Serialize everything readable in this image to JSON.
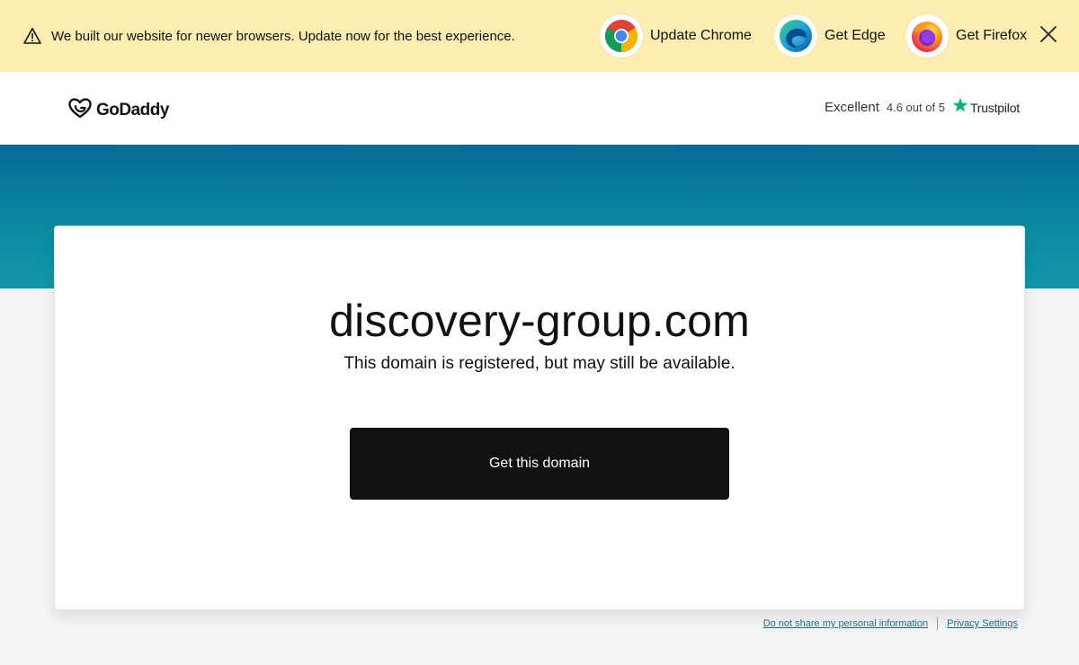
{
  "banner": {
    "message": "We built our website for newer browsers. Update now for the best experience.",
    "browsers": [
      {
        "label": "Update Chrome",
        "icon": "chrome-icon"
      },
      {
        "label": "Get Edge",
        "icon": "edge-icon"
      },
      {
        "label": "Get Firefox",
        "icon": "firefox-icon"
      }
    ],
    "background": "#fdedb1"
  },
  "header": {
    "logo_text": "GoDaddy",
    "trustpilot": {
      "rating_word": "Excellent",
      "score": "4.6 out of 5",
      "brand": "Trustpilot",
      "star_color": "#00b67a"
    }
  },
  "main": {
    "domain": "discovery-group.com",
    "status": "This domain is registered, but may still be available.",
    "cta_label": "Get this domain"
  },
  "footer": {
    "do_not_share": "Do not share my personal information",
    "privacy": "Privacy Settings"
  }
}
